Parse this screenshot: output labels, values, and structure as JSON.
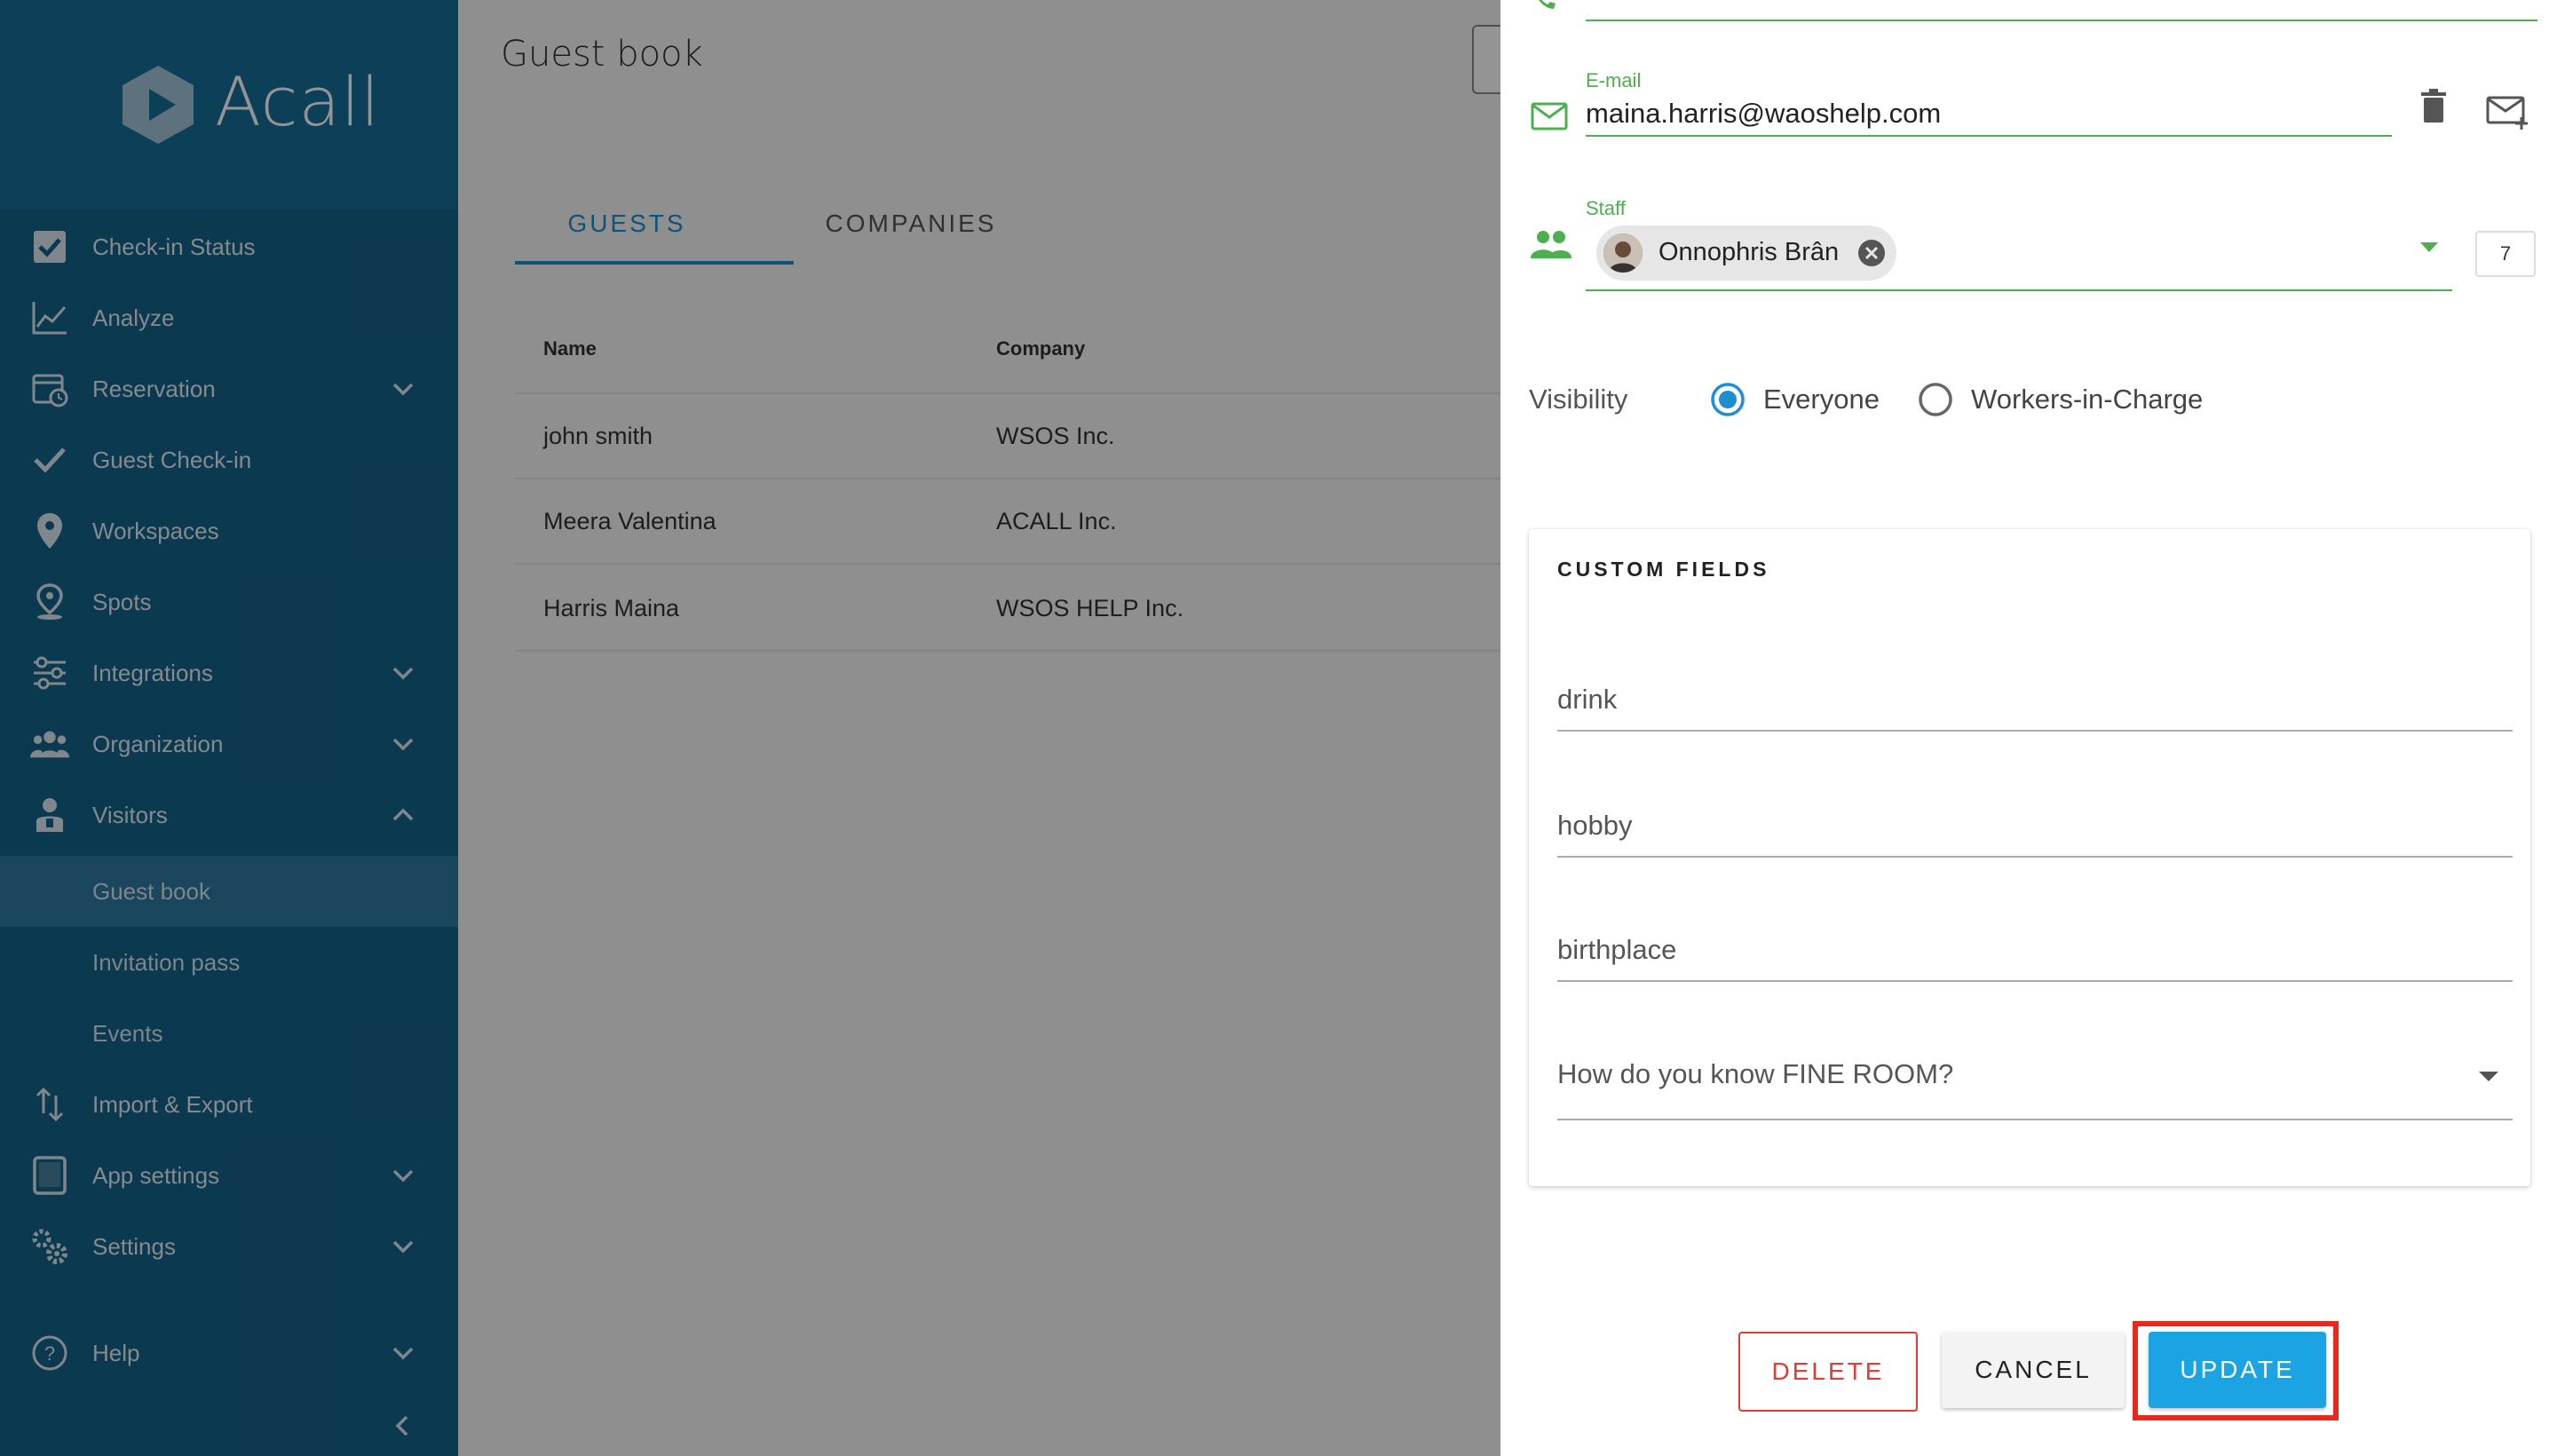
{
  "app": {
    "logo_text": "Acall"
  },
  "sidebar": {
    "items": [
      {
        "label": "Check-in Status",
        "icon": "checkbox-icon"
      },
      {
        "label": "Analyze",
        "icon": "line-chart-icon"
      },
      {
        "label": "Reservation",
        "icon": "calendar-clock-icon",
        "expandable": true
      },
      {
        "label": "Guest Check-in",
        "icon": "check-icon"
      },
      {
        "label": "Workspaces",
        "icon": "location-pin-icon"
      },
      {
        "label": "Spots",
        "icon": "spot-pin-icon"
      },
      {
        "label": "Integrations",
        "icon": "sliders-icon",
        "expandable": true
      },
      {
        "label": "Organization",
        "icon": "people-group-icon",
        "expandable": true
      },
      {
        "label": "Visitors",
        "icon": "visitor-icon",
        "expandable": true,
        "expanded": true
      },
      {
        "label": "Guest book",
        "sub": true,
        "active": true
      },
      {
        "label": "Invitation pass",
        "sub": true
      },
      {
        "label": "Events",
        "sub": true
      },
      {
        "label": "Import & Export",
        "icon": "import-export-icon"
      },
      {
        "label": "App settings",
        "icon": "tablet-icon",
        "expandable": true
      },
      {
        "label": "Settings",
        "icon": "gears-icon",
        "expandable": true
      },
      {
        "label": "Help",
        "icon": "help-circle-icon",
        "expandable": true
      }
    ]
  },
  "main": {
    "title": "Guest book",
    "tabs": [
      {
        "label": "GUESTS",
        "active": true
      },
      {
        "label": "COMPANIES"
      }
    ],
    "columns": [
      "Name",
      "Company"
    ],
    "rows": [
      {
        "name": "john smith",
        "company": "WSOS Inc."
      },
      {
        "name": "Meera Valentina",
        "company": "ACALL Inc."
      },
      {
        "name": "Harris Maina",
        "company": "WSOS HELP Inc."
      }
    ]
  },
  "panel": {
    "email": {
      "label": "E-mail",
      "value": "maina.harris@waoshelp.com"
    },
    "staff": {
      "label": "Staff",
      "chip": "Onnophris Brân",
      "count": "7"
    },
    "visibility": {
      "label": "Visibility",
      "options": [
        {
          "label": "Everyone",
          "selected": true
        },
        {
          "label": "Workers-in-Charge",
          "selected": false
        }
      ]
    },
    "custom_fields": {
      "title": "CUSTOM FIELDS",
      "fields": [
        "drink",
        "hobby",
        "birthplace"
      ],
      "select_placeholder": "How do you know FINE ROOM?"
    },
    "buttons": {
      "delete": "DELETE",
      "cancel": "CANCEL",
      "update": "UPDATE"
    }
  },
  "colors": {
    "sidebar": "#14638a",
    "accent": "#1d8fcf",
    "field_green": "#4caf50",
    "delete_red": "#e53935",
    "update_blue": "#1ca3e3",
    "highlight_red": "#e8271d"
  }
}
